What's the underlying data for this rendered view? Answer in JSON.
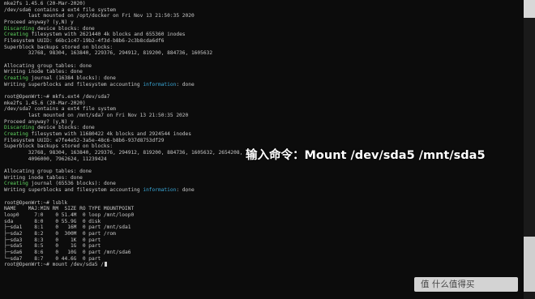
{
  "terminal": {
    "lines": [
      [
        {
          "t": "mke2fs 1.45.6 (20-Mar-2020)"
        }
      ],
      [
        {
          "t": "/dev/sda6 contains a ext4 file system"
        }
      ],
      [
        {
          "t": "        last mounted on /opt/docker on Fri Nov 13 21:50:35 2020"
        }
      ],
      [
        {
          "t": "Proceed anyway? (y,N) y"
        }
      ],
      [
        {
          "t": "Discarding",
          "c": "green"
        },
        {
          "t": " device blocks: done"
        }
      ],
      [
        {
          "t": "Creating",
          "c": "green"
        },
        {
          "t": " filesystem with 2621440 4k blocks and 655360 inodes"
        }
      ],
      [
        {
          "t": "Filesystem UUID: 66bc1c47-19b2-4f3d-b8b6-2c3b8cda6df6"
        }
      ],
      [
        {
          "t": "Superblock backups stored on blocks:"
        }
      ],
      [
        {
          "t": "        32768, 98304, 163840, 229376, 294912, 819200, 884736, 1605632"
        }
      ],
      [
        {
          "t": ""
        }
      ],
      [
        {
          "t": "Allocating group tables: done"
        }
      ],
      [
        {
          "t": "Writing inode tables: done"
        }
      ],
      [
        {
          "t": "Creating",
          "c": "green"
        },
        {
          "t": " journal (16384 blocks): done"
        }
      ],
      [
        {
          "t": "Writing superblocks and filesystem accounting "
        },
        {
          "t": "information",
          "c": "blue"
        },
        {
          "t": ": done"
        }
      ],
      [
        {
          "t": ""
        }
      ],
      [
        {
          "t": "root@OpenWrt:~# mkfs.ext4 /dev/sda7"
        }
      ],
      [
        {
          "t": "mke2fs 1.45.6 (20-Mar-2020)"
        }
      ],
      [
        {
          "t": "/dev/sda7 contains a ext4 file system"
        }
      ],
      [
        {
          "t": "        last mounted on /mnt/sda7 on Fri Nov 13 21:50:35 2020"
        }
      ],
      [
        {
          "t": "Proceed anyway? (y,N) y"
        }
      ],
      [
        {
          "t": "Discarding",
          "c": "green"
        },
        {
          "t": " device blocks: done"
        }
      ],
      [
        {
          "t": "Creating",
          "c": "green"
        },
        {
          "t": " filesystem with 11680422 4k blocks and 2924544 inodes"
        }
      ],
      [
        {
          "t": "Filesystem UUID: e7fe4e52-3a5e-48c6-b8b6-937d8753df29"
        }
      ],
      [
        {
          "t": "Superblock backups stored on blocks:"
        }
      ],
      [
        {
          "t": "        32768, 98304, 163840, 229376, 294912, 819200, 884736, 1605632, 2654208,"
        }
      ],
      [
        {
          "t": "        4096000, 7962624, 11239424"
        }
      ],
      [
        {
          "t": ""
        }
      ],
      [
        {
          "t": "Allocating group tables: done"
        }
      ],
      [
        {
          "t": "Writing inode tables: done"
        }
      ],
      [
        {
          "t": "Creating",
          "c": "green"
        },
        {
          "t": " journal (65536 blocks): done"
        }
      ],
      [
        {
          "t": "Writing superblocks and filesystem accounting "
        },
        {
          "t": "information",
          "c": "blue"
        },
        {
          "t": ": done"
        }
      ],
      [
        {
          "t": ""
        }
      ],
      [
        {
          "t": "root@OpenWrt:~# lsblk"
        }
      ],
      [
        {
          "t": "NAME    MAJ:MIN RM  SIZE RO TYPE MOUNTPOINT"
        }
      ],
      [
        {
          "t": "loop0     7:0    0 51.4M  0 loop /mnt/loop0"
        }
      ],
      [
        {
          "t": "sda       8:0    0 55.9G  0 disk"
        }
      ],
      [
        {
          "t": "├─sda1    8:1    0   16M  0 part /mnt/sda1"
        }
      ],
      [
        {
          "t": "├─sda2    8:2    0  300M  0 part /rom"
        }
      ],
      [
        {
          "t": "├─sda3    8:3    0    1K  0 part"
        }
      ],
      [
        {
          "t": "├─sda5    8:5    0    1G  0 part"
        }
      ],
      [
        {
          "t": "├─sda6    8:6    0   10G  0 part /mnt/sda6"
        }
      ],
      [
        {
          "t": "└─sda7    8:7    0 44.6G  0 part"
        }
      ],
      [
        {
          "t": "root@OpenWrt:~# mount /dev/sda5 /"
        }
      ]
    ]
  },
  "overlay": {
    "caption": "输入命令：Mount /dev/sda5 /mnt/sda5"
  },
  "watermark": {
    "text": "值 什么值得买"
  },
  "colors": {
    "terminal_bg": "#0c0c0c",
    "text": "#c8c8c8",
    "green": "#5fd35f",
    "blue": "#3aa8d8"
  }
}
